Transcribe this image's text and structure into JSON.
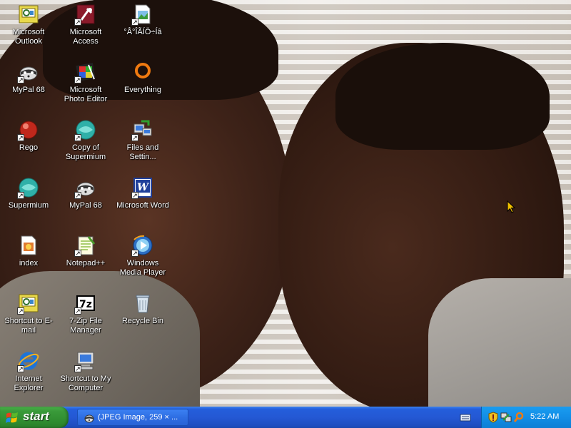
{
  "desktop": {
    "icons": [
      {
        "label": "Microsoft Outlook",
        "icon": "outlook-icon"
      },
      {
        "label": "Microsoft Access",
        "icon": "access-icon"
      },
      {
        "label": "°Â°ÎÃÍÖ÷Íâ",
        "icon": "image-file-icon"
      },
      {
        "label": "MyPal 68",
        "icon": "mypal-raccoon-icon"
      },
      {
        "label": "Microsoft Photo Editor",
        "icon": "photo-editor-icon"
      },
      {
        "label": "Everything",
        "icon": "everything-search-icon"
      },
      {
        "label": "Rego",
        "icon": "rego-red-ball-icon"
      },
      {
        "label": "Copy of Supermium",
        "icon": "supermium-icon"
      },
      {
        "label": "Files and Settin...",
        "icon": "files-settings-transfer-icon"
      },
      {
        "label": "Supermium",
        "icon": "supermium-icon"
      },
      {
        "label": "MyPal 68",
        "icon": "mypal-raccoon-icon"
      },
      {
        "label": "Microsoft Word",
        "icon": "word-icon"
      },
      {
        "label": "index",
        "icon": "html-document-icon"
      },
      {
        "label": "Notepad++",
        "icon": "notepadplusplus-icon"
      },
      {
        "label": "Windows Media Player",
        "icon": "media-player-icon"
      },
      {
        "label": "Shortcut to E-mail",
        "icon": "email-shortcut-icon"
      },
      {
        "label": "7-Zip File Manager",
        "icon": "seven-zip-icon"
      },
      {
        "label": "Recycle Bin",
        "icon": "recycle-bin-icon"
      },
      {
        "label": "Internet Explorer",
        "icon": "internet-explorer-icon"
      },
      {
        "label": "Shortcut to My Computer",
        "icon": "my-computer-icon"
      }
    ]
  },
  "taskbar": {
    "start_label": "start",
    "task_button_label": "(JPEG Image, 259 × ...",
    "clock": "5:22 AM"
  },
  "colors": {
    "taskbar_blue": "#245edb",
    "start_green": "#3a9b3a",
    "tray_blue": "#128ee6"
  }
}
